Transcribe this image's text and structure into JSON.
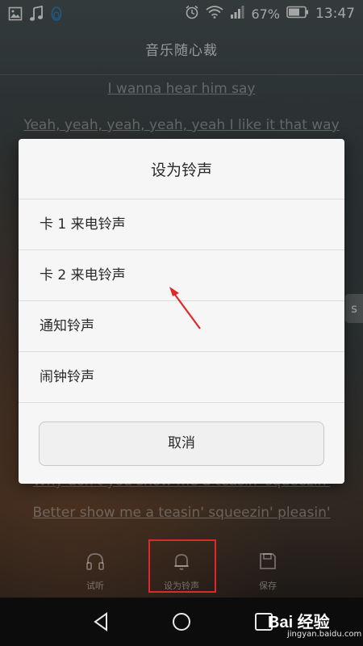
{
  "status_bar": {
    "battery": "67%",
    "time": "13:47",
    "icons": [
      "gallery-icon",
      "music-note-icon",
      "qq-penguin-icon",
      "alarm-icon",
      "wifi-icon",
      "signal-icon",
      "battery-icon"
    ]
  },
  "header": {
    "title": "音乐随心裁"
  },
  "lyrics": {
    "line_top": "I wanna hear him say",
    "line_2": "Yeah, yeah, yeah, yeah, yeah I like it that way",
    "line_side": "s",
    "line_hidden": "Why don't you show me a teasin' squeezin'",
    "line_bottom": "Better show me a teasin' squeezin' pleasin'"
  },
  "dialog": {
    "title": "设为铃声",
    "options": [
      {
        "label": "卡 1 来电铃声"
      },
      {
        "label": "卡 2 来电铃声"
      },
      {
        "label": "通知铃声"
      },
      {
        "label": "闹钟铃声"
      }
    ],
    "cancel_label": "取消"
  },
  "bottom_tabs": [
    {
      "label": "试听",
      "icon": "headphones-icon"
    },
    {
      "label": "设为铃声",
      "icon": "bell-icon"
    },
    {
      "label": "保存",
      "icon": "save-icon"
    }
  ],
  "nav": {
    "icons": [
      "back-icon",
      "home-icon",
      "recents-icon"
    ]
  },
  "watermark": {
    "main": "Bai  经验",
    "sub": "jingyan.baidu.com"
  },
  "colors": {
    "annotation_red": "#e0282b"
  }
}
